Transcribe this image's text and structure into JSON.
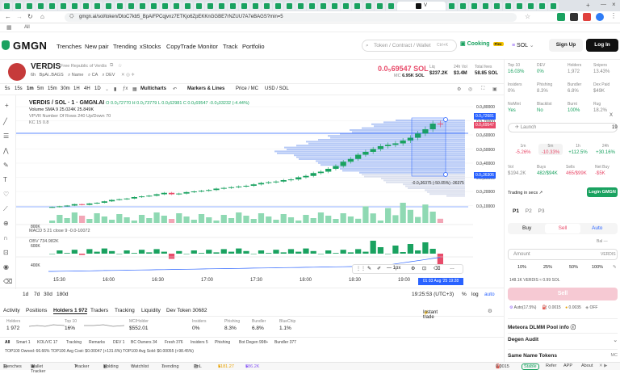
{
  "browser": {
    "active_tab_label": "V",
    "url": "gmgn.ai/sol/token/DtoC7kb5_BpAiFPCqjvnz7ETKjo6ZpEKKnGGBE7rNZUU7A7eBAGS?min=5",
    "bookmarks_label": "All"
  },
  "header": {
    "logo": "GMGN",
    "nav": [
      "Trenches",
      "New pair",
      "Trending",
      "xStocks",
      "CopyTrade",
      "Monitor",
      "Track",
      "Portfolio"
    ],
    "search_placeholder": "Token / Contract / Wallet",
    "search_shortcut": "Ctrl+K",
    "cooking": "Cooking",
    "cooking_badge": "Flex",
    "chain": "SOL",
    "signup": "Sign Up",
    "login": "Log In"
  },
  "token": {
    "symbol": "VERDIS",
    "description": "Free Republic of Verdis",
    "age": "6h",
    "short": "BpAi..BAGS",
    "links": [
      "Name",
      "CA",
      "DEV"
    ],
    "price": "0.0₅69547 SOL",
    "mc_label": "MC",
    "mc": "6.95K SOL",
    "liq_label": "Liq",
    "liq": "$237.2K",
    "vol_label": "24h Vol",
    "vol": "$3.4M",
    "fees_label": "Total fees",
    "fees": "58.85 SOL"
  },
  "chart_toolbar": {
    "intervals": [
      "5s",
      "15s",
      "1m",
      "5m",
      "15m",
      "30m",
      "1H",
      "4H",
      "1D"
    ],
    "active_interval": "1m",
    "multicharts": "Multicharts",
    "markers": "Markers & Lines",
    "price_mc": "Price / MC",
    "usd_sol": "USD / SOL"
  },
  "legend": {
    "title": "VERDIS / SOL · 1 · GMGN.AI",
    "ohlc": "O 0.0₅72770  H 0.0₅73779  L 0.0₅62981  C 0.0₅69547  -0.0₅03232 (-4.44%)",
    "volume": "Volume  SMA 9  25.024K  25.849K",
    "vpvr": "VPVR  Number Of Rows 240 Up/Down 70",
    "kc": "KC  15 0.8",
    "macd": "MACD 5 21 close 9   -0.0-10072",
    "obv": "OBV  734.982K",
    "measure": "-0.0₅36375 (-50.05%) -36375"
  },
  "chart_data": {
    "type": "candlestick",
    "x_ticks": [
      "15:30",
      "16:00",
      "16:30",
      "17:00",
      "17:30",
      "18:00",
      "18:30",
      "19:00"
    ],
    "y_ticks": [
      "0.0₅80000",
      "0.0₅70000",
      "0.0₅60000",
      "0.0₅50000",
      "0.0₅40000",
      "0.0₅30000",
      "0.0₅20000",
      "0.0₅10000"
    ],
    "price_badges": [
      "0.0₅72681",
      "0.0₅69547",
      "0.0₅36306"
    ],
    "volume_scale": [
      "800K",
      "600K",
      "400K"
    ],
    "close_series": [
      1.1,
      1.15,
      1.2,
      1.3,
      1.25,
      1.35,
      1.4,
      1.5,
      1.6,
      1.65,
      1.7,
      1.8,
      1.85,
      1.9,
      2.0,
      2.1,
      2.0,
      2.05,
      2.15,
      2.2,
      2.25,
      2.3,
      2.4,
      2.45,
      2.5,
      2.55,
      2.6,
      2.7,
      2.8,
      2.85,
      2.9,
      3.0,
      3.05,
      3.2,
      3.3,
      3.5,
      3.6,
      3.8,
      4.0,
      4.3,
      4.5,
      4.8,
      5.0,
      5.2,
      5.4,
      5.5,
      5.6,
      5.8,
      6.0,
      6.3,
      6.6,
      7.0,
      6.95
    ]
  },
  "time_axis": {
    "clock": "19:25:53 (UTC+3)",
    "pct": "%",
    "log": "log",
    "auto": "auto",
    "date": "01 03 Aug '25 19:28"
  },
  "ranges": [
    "1d",
    "7d",
    "30d",
    "180d"
  ],
  "bottom_tabs": [
    "Activity",
    "Positions",
    "Holders 1 972",
    "Traders",
    "Tracking",
    "Liquidity",
    "Dev Token 30682"
  ],
  "active_bottom_tab": "Holders 1 972",
  "instant_trade": "Instant trade",
  "holder_stats": [
    {
      "label": "Holders",
      "value": "1 972"
    },
    {
      "label": "Top 10",
      "value": "16%"
    },
    {
      "label": "MC/Holder",
      "value": "$552.01"
    },
    {
      "label": "Insiders",
      "value": "0%"
    },
    {
      "label": "Phishing",
      "value": "8.3%"
    },
    {
      "label": "Bundler",
      "value": "6.8%"
    },
    {
      "label": "BlueChip",
      "value": "1.1%"
    }
  ],
  "filters": [
    "All",
    "Smart 1",
    "KOL/VC 17",
    "Tracking",
    "Remarks",
    "DEV 1",
    "BC Owners 34",
    "Fresh 376",
    "Insiders 5",
    "Phishing",
    "Bot Degen 998+",
    "Bundler 377"
  ],
  "top100": "TOP100 Owned: 66.66%  TOP100 Avg Cost: $0.00047 (+131.6%)  TOP100 Avg Sold: $0.00055 (+98.45%)",
  "footer": [
    "Trenches",
    "Wallet Tracker",
    "Tracker",
    "Holding",
    "Watchlist",
    "Trending",
    "PnL",
    "$181.27",
    "$86.2K",
    "Stable",
    "0.0015",
    "Refer",
    "APP",
    "About"
  ],
  "right": {
    "grid": [
      {
        "label": "Top 10",
        "value": "16.03%",
        "color": "green"
      },
      {
        "label": "DEV",
        "value": "0%",
        "color": "green"
      },
      {
        "label": "Holders",
        "value": "1,972",
        "color": ""
      },
      {
        "label": "Snipers",
        "value": "13.43%",
        "color": ""
      },
      {
        "label": "Insiders",
        "value": "0%",
        "color": ""
      },
      {
        "label": "Phishing",
        "value": "8.3%",
        "color": ""
      },
      {
        "label": "Bundler",
        "value": "6.8%",
        "color": ""
      },
      {
        "label": "Dex Paid",
        "value": "$49K",
        "color": ""
      },
      {
        "label": "NoMint",
        "value": "Yes",
        "color": "green"
      },
      {
        "label": "Blacklist",
        "value": "No",
        "color": "green"
      },
      {
        "label": "Burnt",
        "value": "100%",
        "color": "green"
      },
      {
        "label": "Rug",
        "value": "18.2%",
        "color": ""
      }
    ],
    "launch": "Launch",
    "launch_count": "19",
    "periods": [
      {
        "label": "1m",
        "value": "-5.26%",
        "color": "red"
      },
      {
        "label": "5m",
        "value": "-10.33%",
        "color": "red"
      },
      {
        "label": "1h",
        "value": "+112.5%",
        "color": "green"
      },
      {
        "label": "24h",
        "value": "+30.16%",
        "color": "green"
      }
    ],
    "flows": [
      {
        "label": "Vol",
        "value": "$194.2K"
      },
      {
        "label": "Buys",
        "value": "482/$94K"
      },
      {
        "label": "Sells",
        "value": "465/$99K"
      },
      {
        "label": "Net Buy",
        "value": "-$5K"
      }
    ],
    "trading_in_secs": "Trading in secs",
    "login_gmgn": "Login GMGN",
    "presets": [
      "P1",
      "P2",
      "P3"
    ],
    "buy": "Buy",
    "sell": "Sell",
    "auto": "Auto",
    "bal": "Bal —",
    "amount": "Amount",
    "amount_unit": "VERDIS",
    "pcts": [
      "10%",
      "25%",
      "50%",
      "100%"
    ],
    "conv": "148.1K VERDIS ≈ 0.99 SOL",
    "sell_btn": "Sell",
    "auto_label": "Auto(17.5%)",
    "fee1": "0.0015",
    "fee2": "0.0035",
    "off": "OFF",
    "sections": [
      "Meteora DLMM Pool info",
      "Degen Audit",
      "Same Name Tokens"
    ],
    "mc_label": "MC"
  }
}
